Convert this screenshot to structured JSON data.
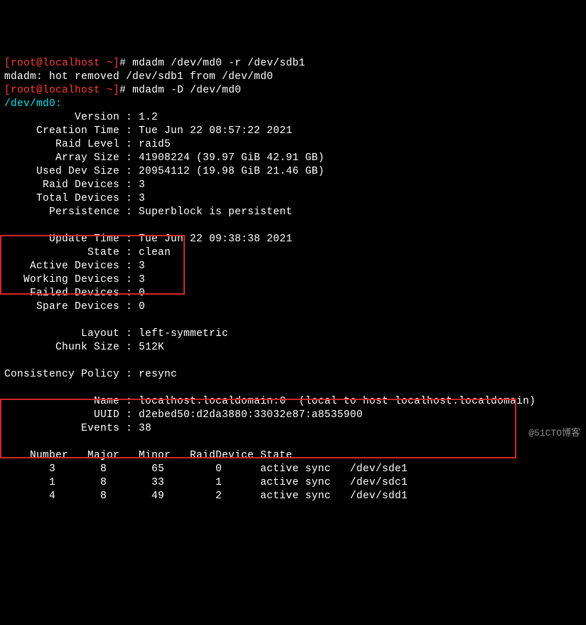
{
  "prompt1": {
    "open": "[",
    "user_host": "root@localhost ~",
    "close": "]",
    "hash": "#",
    "cmd": " mdadm /dev/md0 -r /dev/sdb1"
  },
  "line_out1": "mdadm: hot removed /dev/sdb1 from /dev/md0",
  "prompt2": {
    "open": "[",
    "user_host": "root@localhost ~",
    "close": "]",
    "hash": "#",
    "cmd": " mdadm -D /dev/md0"
  },
  "dev_header": "/dev/md0:",
  "fields": {
    "version_l": "           Version :",
    "version_v": " 1.2",
    "ctime_l": "     Creation Time :",
    "ctime_v": " Tue Jun 22 08:57:22 2021",
    "rlevel_l": "        Raid Level :",
    "rlevel_v": " raid5",
    "asize_l": "        Array Size :",
    "asize_v": " 41908224 (39.97 GiB 42.91 GB)",
    "usize_l": "     Used Dev Size :",
    "usize_v": " 20954112 (19.98 GiB 21.46 GB)",
    "rdev_l": "      Raid Devices :",
    "rdev_v": " 3",
    "tdev_l": "     Total Devices :",
    "tdev_v": " 3",
    "pers_l": "       Persistence :",
    "pers_v": " Superblock is persistent",
    "utime_l": "       Update Time :",
    "utime_v": " Tue Jun 22 09:38:38 2021",
    "state_l": "             State :",
    "state_v": " clean",
    "adev_l": "    Active Devices :",
    "adev_v": " 3",
    "wdev_l": "   Working Devices :",
    "wdev_v": " 3",
    "fdev_l": "    Failed Devices :",
    "fdev_v": " 0",
    "sdev_l": "     Spare Devices :",
    "sdev_v": " 0",
    "layout_l": "            Layout :",
    "layout_v": " left-symmetric",
    "chunk_l": "        Chunk Size :",
    "chunk_v": " 512K",
    "cpol_l": "Consistency Policy :",
    "cpol_v": " resync",
    "name_l": "              Name :",
    "name_v": " localhost.localdomain:0  (local to host localhost.localdomain)",
    "uuid_l": "              UUID :",
    "uuid_v": " d2ebed50:d2da3880:33032e87:a8535900",
    "events_l": "            Events :",
    "events_v": " 38"
  },
  "table": {
    "header": "    Number   Major   Minor   RaidDevice State",
    "rows": [
      "       3       8       65        0      active sync   /dev/sde1",
      "       1       8       33        1      active sync   /dev/sdc1",
      "       4       8       49        2      active sync   /dev/sdd1"
    ]
  },
  "watermark": "@51CTO博客"
}
